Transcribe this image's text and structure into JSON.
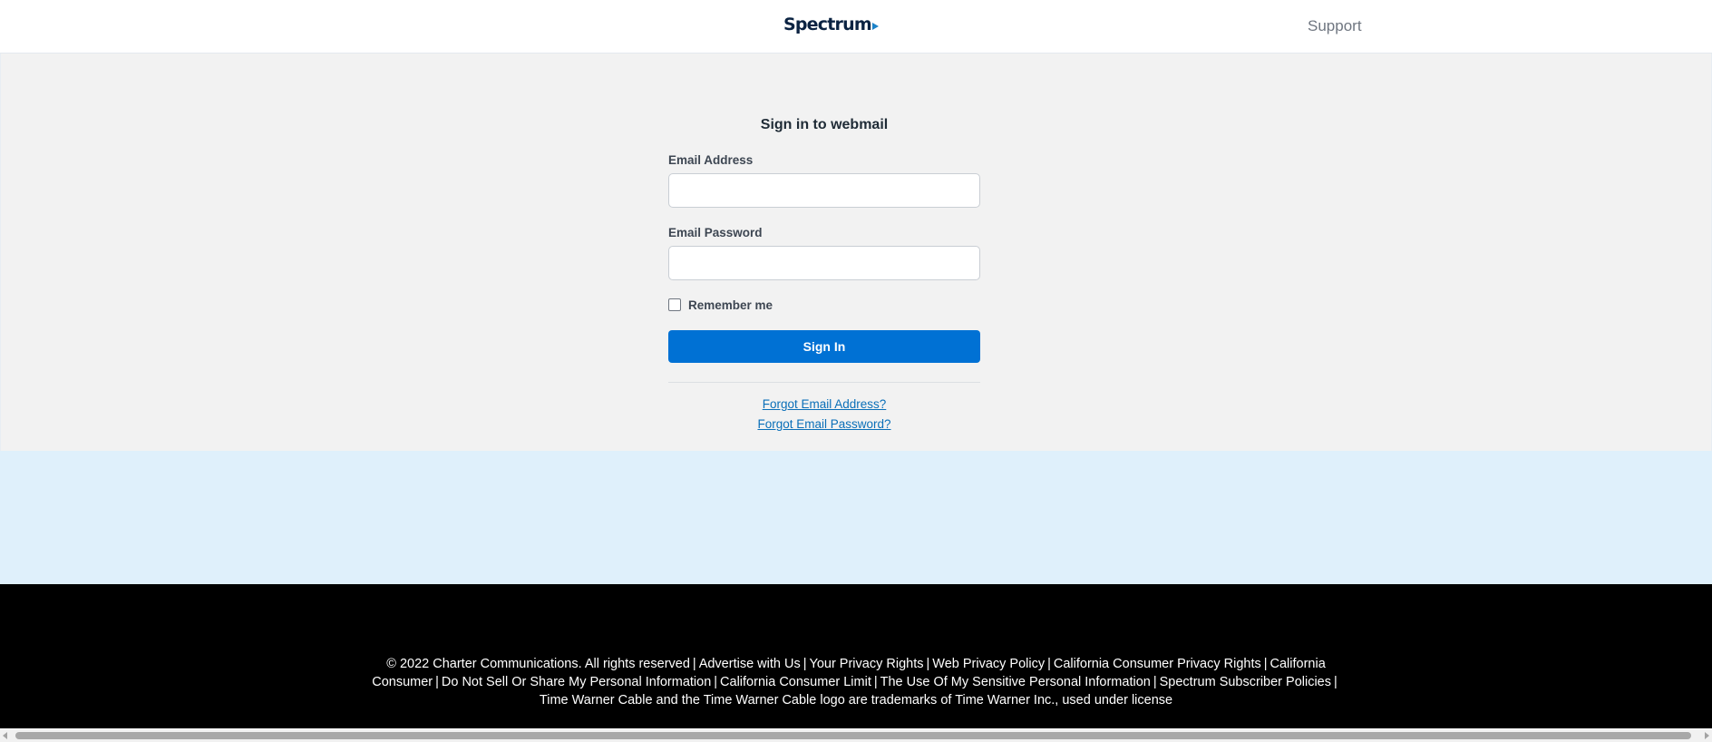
{
  "header": {
    "logo_text": "Spectrum",
    "support_label": "Support"
  },
  "form": {
    "title": "Sign in to webmail",
    "email_label": "Email Address",
    "email_value": "",
    "password_label": "Email Password",
    "password_value": "",
    "remember_label": "Remember me",
    "remember_checked": false,
    "signin_label": "Sign In",
    "forgot_email_label": "Forgot Email Address?",
    "forgot_password_label": "Forgot Email Password?"
  },
  "footer": {
    "separator": "|",
    "links": [
      "© 2022 Charter Communications. All rights reserved",
      "Advertise with Us",
      "Your Privacy Rights",
      "Web Privacy Policy",
      "California Consumer Privacy Rights",
      "California Consumer",
      "Do Not Sell Or Share My Personal Information",
      "California Consumer Limit",
      "The Use Of My Sensitive Personal Information",
      "Spectrum Subscriber Policies"
    ],
    "trademark": "Time Warner Cable and the Time Warner Cable logo are trademarks of Time Warner Inc., used under license"
  },
  "colors": {
    "accent_blue": "#0071d4",
    "link_blue": "#0a6fb8",
    "band_blue": "#dff0fb",
    "form_background": "#f2f2f2",
    "footer_background": "#000000"
  },
  "icons": {
    "logo_mark": "play-triangle-icon",
    "scroll_left": "chevron-left-icon",
    "scroll_right": "chevron-right-icon"
  }
}
